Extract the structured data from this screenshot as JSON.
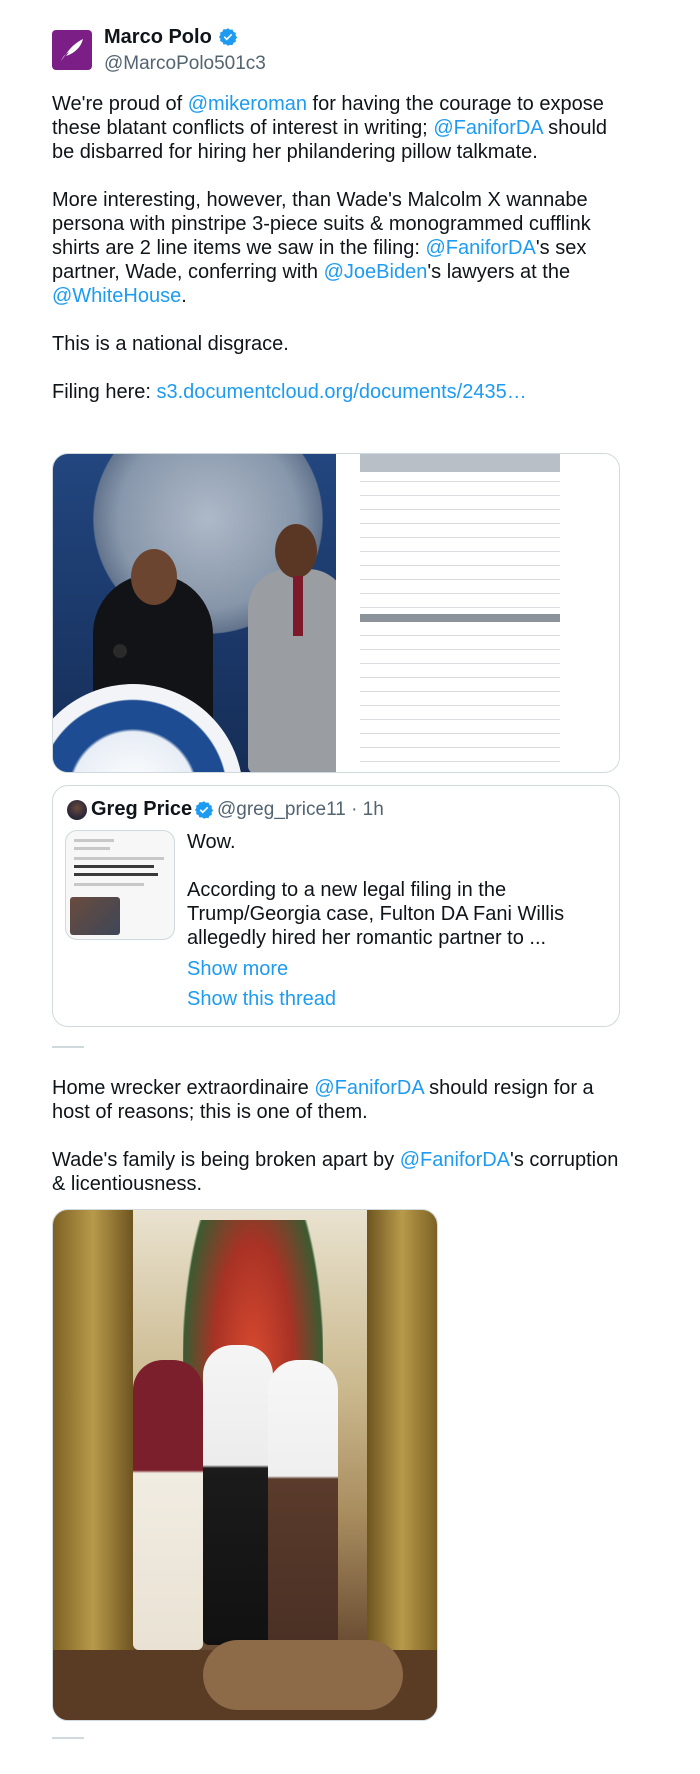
{
  "author": {
    "display_name": "Marco Polo",
    "handle": "@MarcoPolo501c3",
    "verified": true
  },
  "tweet1": {
    "p1": [
      {
        "t": "We're proud of ",
        "link": false
      },
      {
        "t": "@mikeroman",
        "link": true
      },
      {
        "t": " for having the courage to expose these blatant conflicts of interest in writing; ",
        "link": false
      },
      {
        "t": "@FaniforDA",
        "link": true
      },
      {
        "t": " should be disbarred for hiring her philandering pillow talkmate.",
        "link": false
      }
    ],
    "p2": [
      {
        "t": "More interesting, however, than Wade's Malcolm X wannabe persona with pinstripe 3-piece suits & monogrammed cufflink shirts are 2 line items we saw in the filing: ",
        "link": false
      },
      {
        "t": "@FaniforDA",
        "link": true
      },
      {
        "t": "'s sex partner, Wade, conferring with ",
        "link": false
      },
      {
        "t": "@JoeBiden",
        "link": true
      },
      {
        "t": "'s lawyers at the ",
        "link": false
      },
      {
        "t": "@WhiteHouse",
        "link": true
      },
      {
        "t": ".",
        "link": false
      }
    ],
    "p3": "This is a national disgrace.",
    "filing_prefix": "Filing here: ",
    "filing_link": "s3.documentcloud.org/documents/2435…"
  },
  "quote": {
    "display_name": "Greg Price",
    "handle_time": "@greg_price11 · 1h",
    "line1": "Wow.",
    "line2": "According to a new legal filing in the Trump/Georgia case, Fulton DA Fani Willis allegedly hired her romantic partner to ...",
    "show_more": "Show more",
    "show_thread": "Show this thread"
  },
  "tweet2": {
    "p1": [
      {
        "t": "Home wrecker extraordinaire ",
        "link": false
      },
      {
        "t": "@FaniforDA",
        "link": true
      },
      {
        "t": " should resign for a host of reasons; this is one of them.",
        "link": false
      }
    ],
    "p2": [
      {
        "t": "Wade's family is being broken apart by ",
        "link": false
      },
      {
        "t": "@FaniforDA",
        "link": true
      },
      {
        "t": "'s corruption & licentiousness.",
        "link": false
      }
    ]
  },
  "colors": {
    "link": "#1d9bf0",
    "text": "#0f1419",
    "muted": "#536471",
    "border": "#cfd9de",
    "verified": "#1d9bf0",
    "avatar_bg": "#7b1f86"
  },
  "icons": [
    "feather-logo-icon",
    "verified-badge-icon"
  ]
}
